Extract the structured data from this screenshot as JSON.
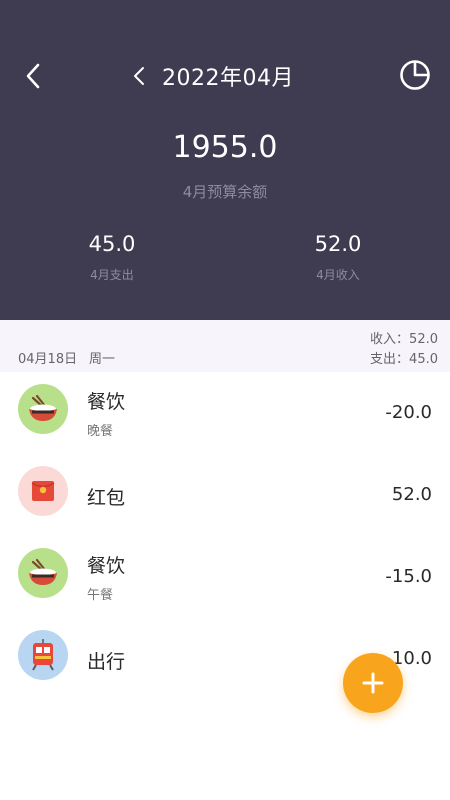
{
  "header": {
    "month_title": "2022年04月",
    "balance": "1955.0",
    "balance_label": "4月预算余额",
    "expense_value": "45.0",
    "expense_label": "4月支出",
    "income_value": "52.0",
    "income_label": "4月收入"
  },
  "day": {
    "date": "04月18日",
    "weekday": "周一",
    "income": "收入：52.0",
    "expense": "支出：45.0"
  },
  "transactions": [
    {
      "category": "餐饮",
      "note": "晚餐",
      "amount": "-20.0",
      "icon": "rice-bowl-icon"
    },
    {
      "category": "红包",
      "note": "",
      "amount": "52.0",
      "icon": "red-envelope-icon"
    },
    {
      "category": "餐饮",
      "note": "午餐",
      "amount": "-15.0",
      "icon": "rice-bowl-icon"
    },
    {
      "category": "出行",
      "note": "",
      "amount": "-10.0",
      "icon": "train-icon"
    }
  ],
  "colors": {
    "header_bg": "#3f3b51",
    "fab": "#f8a51d",
    "food_icon_bg": "#b8e08a",
    "envelope_icon_bg": "#fbd9d6",
    "travel_icon_bg": "#b8d6f2"
  }
}
